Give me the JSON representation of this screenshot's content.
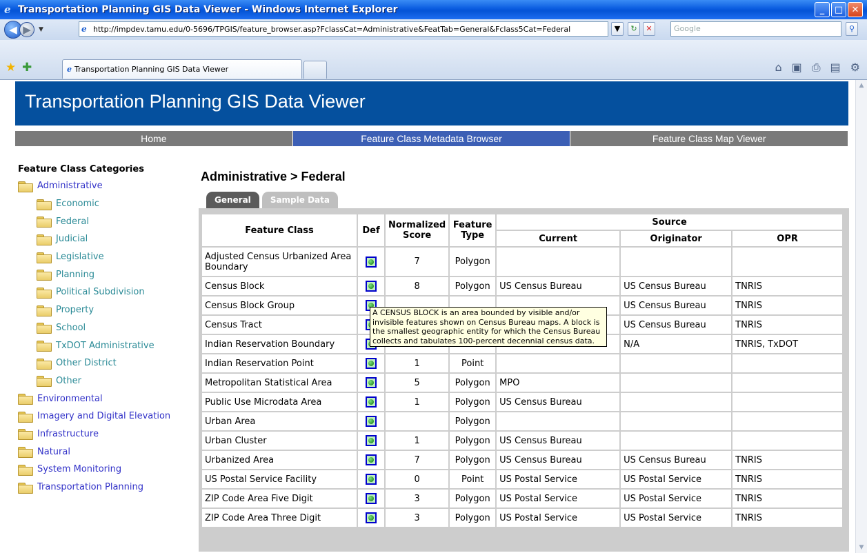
{
  "window": {
    "title": "Transportation Planning GIS Data Viewer - Windows Internet Explorer",
    "controls": {
      "minimize": "_",
      "maximize": "□",
      "close": "✕"
    }
  },
  "addressbar": {
    "url": "http://impdev.tamu.edu/0-5696/TPGIS/feature_browser.asp?FclassCat=Administrative&FeatTab=General&Fclass5Cat=Federal",
    "search_placeholder": "Google"
  },
  "browser_tab": {
    "title": "Transportation Planning GIS Data Viewer"
  },
  "page": {
    "banner_title": "Transportation Planning GIS Data Viewer",
    "nav": [
      "Home",
      "Feature Class Metadata Browser",
      "Feature Class Map Viewer"
    ],
    "active_nav": "Feature Class Metadata Browser",
    "heading": "Administrative > Federal",
    "tabs": [
      "General",
      "Sample Data"
    ]
  },
  "sidebar": {
    "title": "Feature Class Categories",
    "categories": [
      {
        "label": "Administrative",
        "level": 0
      },
      {
        "label": "Economic",
        "level": 1
      },
      {
        "label": "Federal",
        "level": 1
      },
      {
        "label": "Judicial",
        "level": 1
      },
      {
        "label": "Legislative",
        "level": 1
      },
      {
        "label": "Planning",
        "level": 1
      },
      {
        "label": "Political Subdivision",
        "level": 1
      },
      {
        "label": "Property",
        "level": 1
      },
      {
        "label": "School",
        "level": 1
      },
      {
        "label": "TxDOT Administrative",
        "level": 1
      },
      {
        "label": "Other District",
        "level": 1
      },
      {
        "label": "Other",
        "level": 1
      },
      {
        "label": "Environmental",
        "level": 0
      },
      {
        "label": "Imagery and Digital Elevation",
        "level": 0
      },
      {
        "label": "Infrastructure",
        "level": 0
      },
      {
        "label": "Natural",
        "level": 0
      },
      {
        "label": "System Monitoring",
        "level": 0
      },
      {
        "label": "Transportation Planning",
        "level": 0
      }
    ]
  },
  "table": {
    "headers": {
      "feature_class": "Feature Class",
      "def": "Def",
      "score": "Normalized Score",
      "type": "Feature Type",
      "source": "Source",
      "current": "Current",
      "originator": "Originator",
      "opr": "OPR"
    },
    "rows": [
      {
        "name": "Adjusted Census Urbanized Area Boundary",
        "score": "7",
        "type": "Polygon",
        "current": "",
        "originator": "",
        "opr": ""
      },
      {
        "name": "Census Block",
        "score": "8",
        "type": "Polygon",
        "current": "US Census Bureau",
        "originator": "US Census Bureau",
        "opr": "TNRIS"
      },
      {
        "name": "Census Block Group",
        "score": "",
        "type": "",
        "current": "",
        "originator": "US Census Bureau",
        "opr": "TNRIS"
      },
      {
        "name": "Census Tract",
        "score": "",
        "type": "",
        "current": "",
        "originator": "US Census Bureau",
        "opr": "TNRIS"
      },
      {
        "name": "Indian Reservation Boundary",
        "score": "",
        "type": "",
        "current": "",
        "originator": "N/A",
        "opr": "TNRIS, TxDOT"
      },
      {
        "name": "Indian Reservation Point",
        "score": "1",
        "type": "Point",
        "current": "",
        "originator": "",
        "opr": ""
      },
      {
        "name": "Metropolitan Statistical Area",
        "score": "5",
        "type": "Polygon",
        "current": "MPO",
        "originator": "",
        "opr": ""
      },
      {
        "name": "Public Use Microdata Area",
        "score": "1",
        "type": "Polygon",
        "current": "US Census Bureau",
        "originator": "",
        "opr": ""
      },
      {
        "name": "Urban Area",
        "score": "",
        "type": "Polygon",
        "current": "",
        "originator": "",
        "opr": ""
      },
      {
        "name": "Urban Cluster",
        "score": "1",
        "type": "Polygon",
        "current": "US Census Bureau",
        "originator": "",
        "opr": ""
      },
      {
        "name": "Urbanized Area",
        "score": "7",
        "type": "Polygon",
        "current": "US Census Bureau",
        "originator": "US Census Bureau",
        "opr": "TNRIS"
      },
      {
        "name": "US Postal Service Facility",
        "score": "0",
        "type": "Point",
        "current": "US Postal Service",
        "originator": "US Postal Service",
        "opr": "TNRIS"
      },
      {
        "name": "ZIP Code Area Five Digit",
        "score": "3",
        "type": "Polygon",
        "current": "US Postal Service",
        "originator": "US Postal Service",
        "opr": "TNRIS"
      },
      {
        "name": "ZIP Code Area Three Digit",
        "score": "3",
        "type": "Polygon",
        "current": "US Postal Service",
        "originator": "US Postal Service",
        "opr": "TNRIS"
      }
    ]
  },
  "tooltip": {
    "text": "A CENSUS BLOCK is an area bounded by visible and/or invisible features shown on Census Bureau maps.  A block is the smallest geographic entity for which the Census Bureau collects and tabulates 100-percent decennial census data."
  },
  "colors": {
    "banner": "#05509e",
    "nav_active": "#3c5fb5",
    "nav_inactive": "#7a7a7a",
    "link": "#3232c8",
    "sublink": "#2a8a96",
    "tooltip_bg": "#ffffe1"
  }
}
